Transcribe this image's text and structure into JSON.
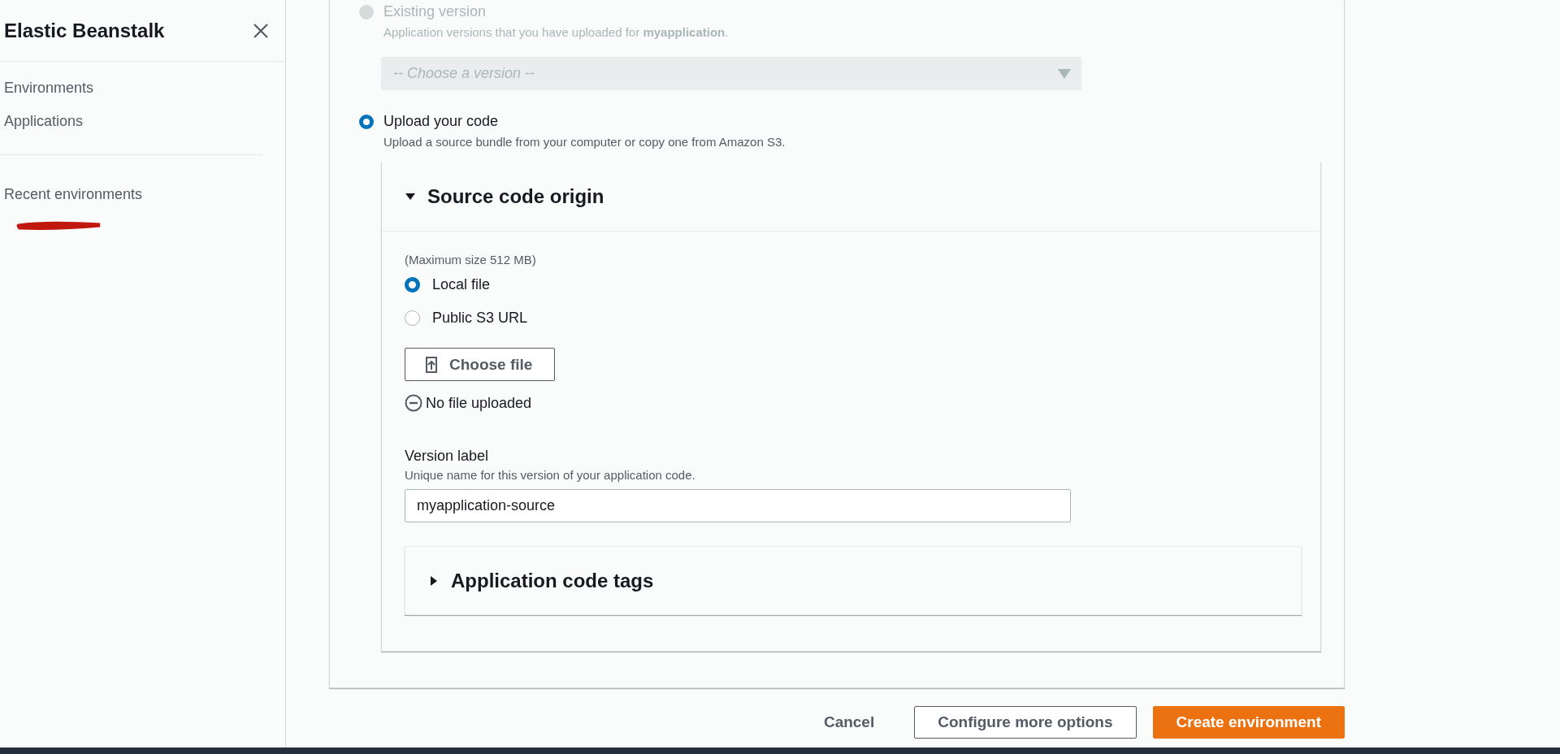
{
  "sidebar": {
    "title": "Elastic Beanstalk",
    "nav": [
      {
        "label": "Environments"
      },
      {
        "label": "Applications"
      }
    ],
    "recent_heading": "Recent environments"
  },
  "source": {
    "options": [
      {
        "label": "Existing version",
        "description": "Application versions that you have uploaded for **myapplication**.",
        "selected": false,
        "disabled": true
      },
      {
        "label": "Upload your code",
        "description": "Upload a source bundle from your computer or copy one from Amazon S3.",
        "selected": true,
        "disabled": false
      }
    ],
    "version_select": {
      "placeholder": "-- Choose a version --",
      "disabled": true
    },
    "origin": {
      "title": "Source code origin",
      "expanded": true,
      "max_size": "(Maximum size 512 MB)",
      "choices": [
        {
          "label": "Local file",
          "selected": true
        },
        {
          "label": "Public S3 URL",
          "selected": false
        }
      ],
      "choose_button": "Choose file",
      "file_status": "No file uploaded",
      "version_label": {
        "label": "Version label",
        "hint": "Unique name for this version of your application code.",
        "value": "myapplication-source"
      },
      "tags": {
        "title": "Application code tags",
        "expanded": false
      }
    }
  },
  "actions": [
    {
      "label": "Cancel",
      "kind": "link"
    },
    {
      "label": "Configure more options",
      "kind": "secondary"
    },
    {
      "label": "Create environment",
      "kind": "primary"
    }
  ]
}
